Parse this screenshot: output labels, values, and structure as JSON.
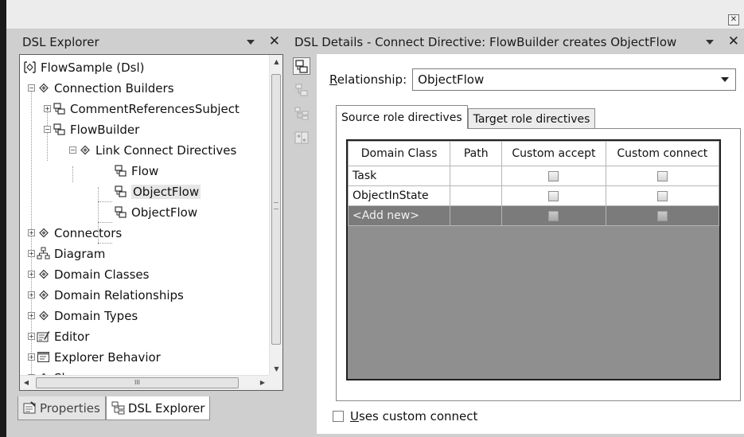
{
  "explorer": {
    "title": "DSL Explorer",
    "close_glyph": "✕",
    "tree": {
      "root": "FlowSample (Dsl)",
      "connection_builders": "Connection Builders",
      "builder_comment": "CommentReferencesSubject",
      "builder_flow": "FlowBuilder",
      "link_connect_directives": "Link Connect Directives",
      "directive_flow": "Flow",
      "directive_objectflow_selected": "ObjectFlow",
      "directive_objectflow": "ObjectFlow",
      "connectors": "Connectors",
      "diagram": "Diagram",
      "domain_classes": "Domain Classes",
      "domain_relationships": "Domain Relationships",
      "domain_types": "Domain Types",
      "editor": "Editor",
      "explorer_behavior": "Explorer Behavior",
      "shapes": "Shapes"
    },
    "hscroll_grip": "III",
    "bottom_tabs": [
      {
        "label": "Properties",
        "icon": "properties-icon"
      },
      {
        "label": "DSL Explorer",
        "icon": "dsl-explorer-icon"
      }
    ]
  },
  "details": {
    "title": "DSL Details - Connect Directive: FlowBuilder creates ObjectFlow",
    "close_glyph": "✕",
    "relationship_label_underlined": "R",
    "relationship_label_rest": "elationship:",
    "relationship_value": "ObjectFlow",
    "tabs": [
      "Source role directives",
      "Target role directives"
    ],
    "grid": {
      "columns": [
        "Domain Class",
        "Path",
        "Custom accept",
        "Custom connect"
      ],
      "rows": [
        {
          "domain_class": "Task",
          "path": "",
          "custom_accept": false,
          "custom_connect": false
        },
        {
          "domain_class": "ObjectInState",
          "path": "",
          "custom_accept": false,
          "custom_connect": false
        },
        {
          "domain_class": "<Add new>",
          "path": "",
          "custom_accept": false,
          "custom_connect": false
        }
      ]
    },
    "uses_custom_connect_underlined": "U",
    "uses_custom_connect_rest": "ses custom connect",
    "uses_custom_connect_checked": false
  },
  "colors": {
    "background": "#cfcfcf",
    "grid_empty_area": "#8f8f8f",
    "add_new_row": "#7b7b7b"
  }
}
